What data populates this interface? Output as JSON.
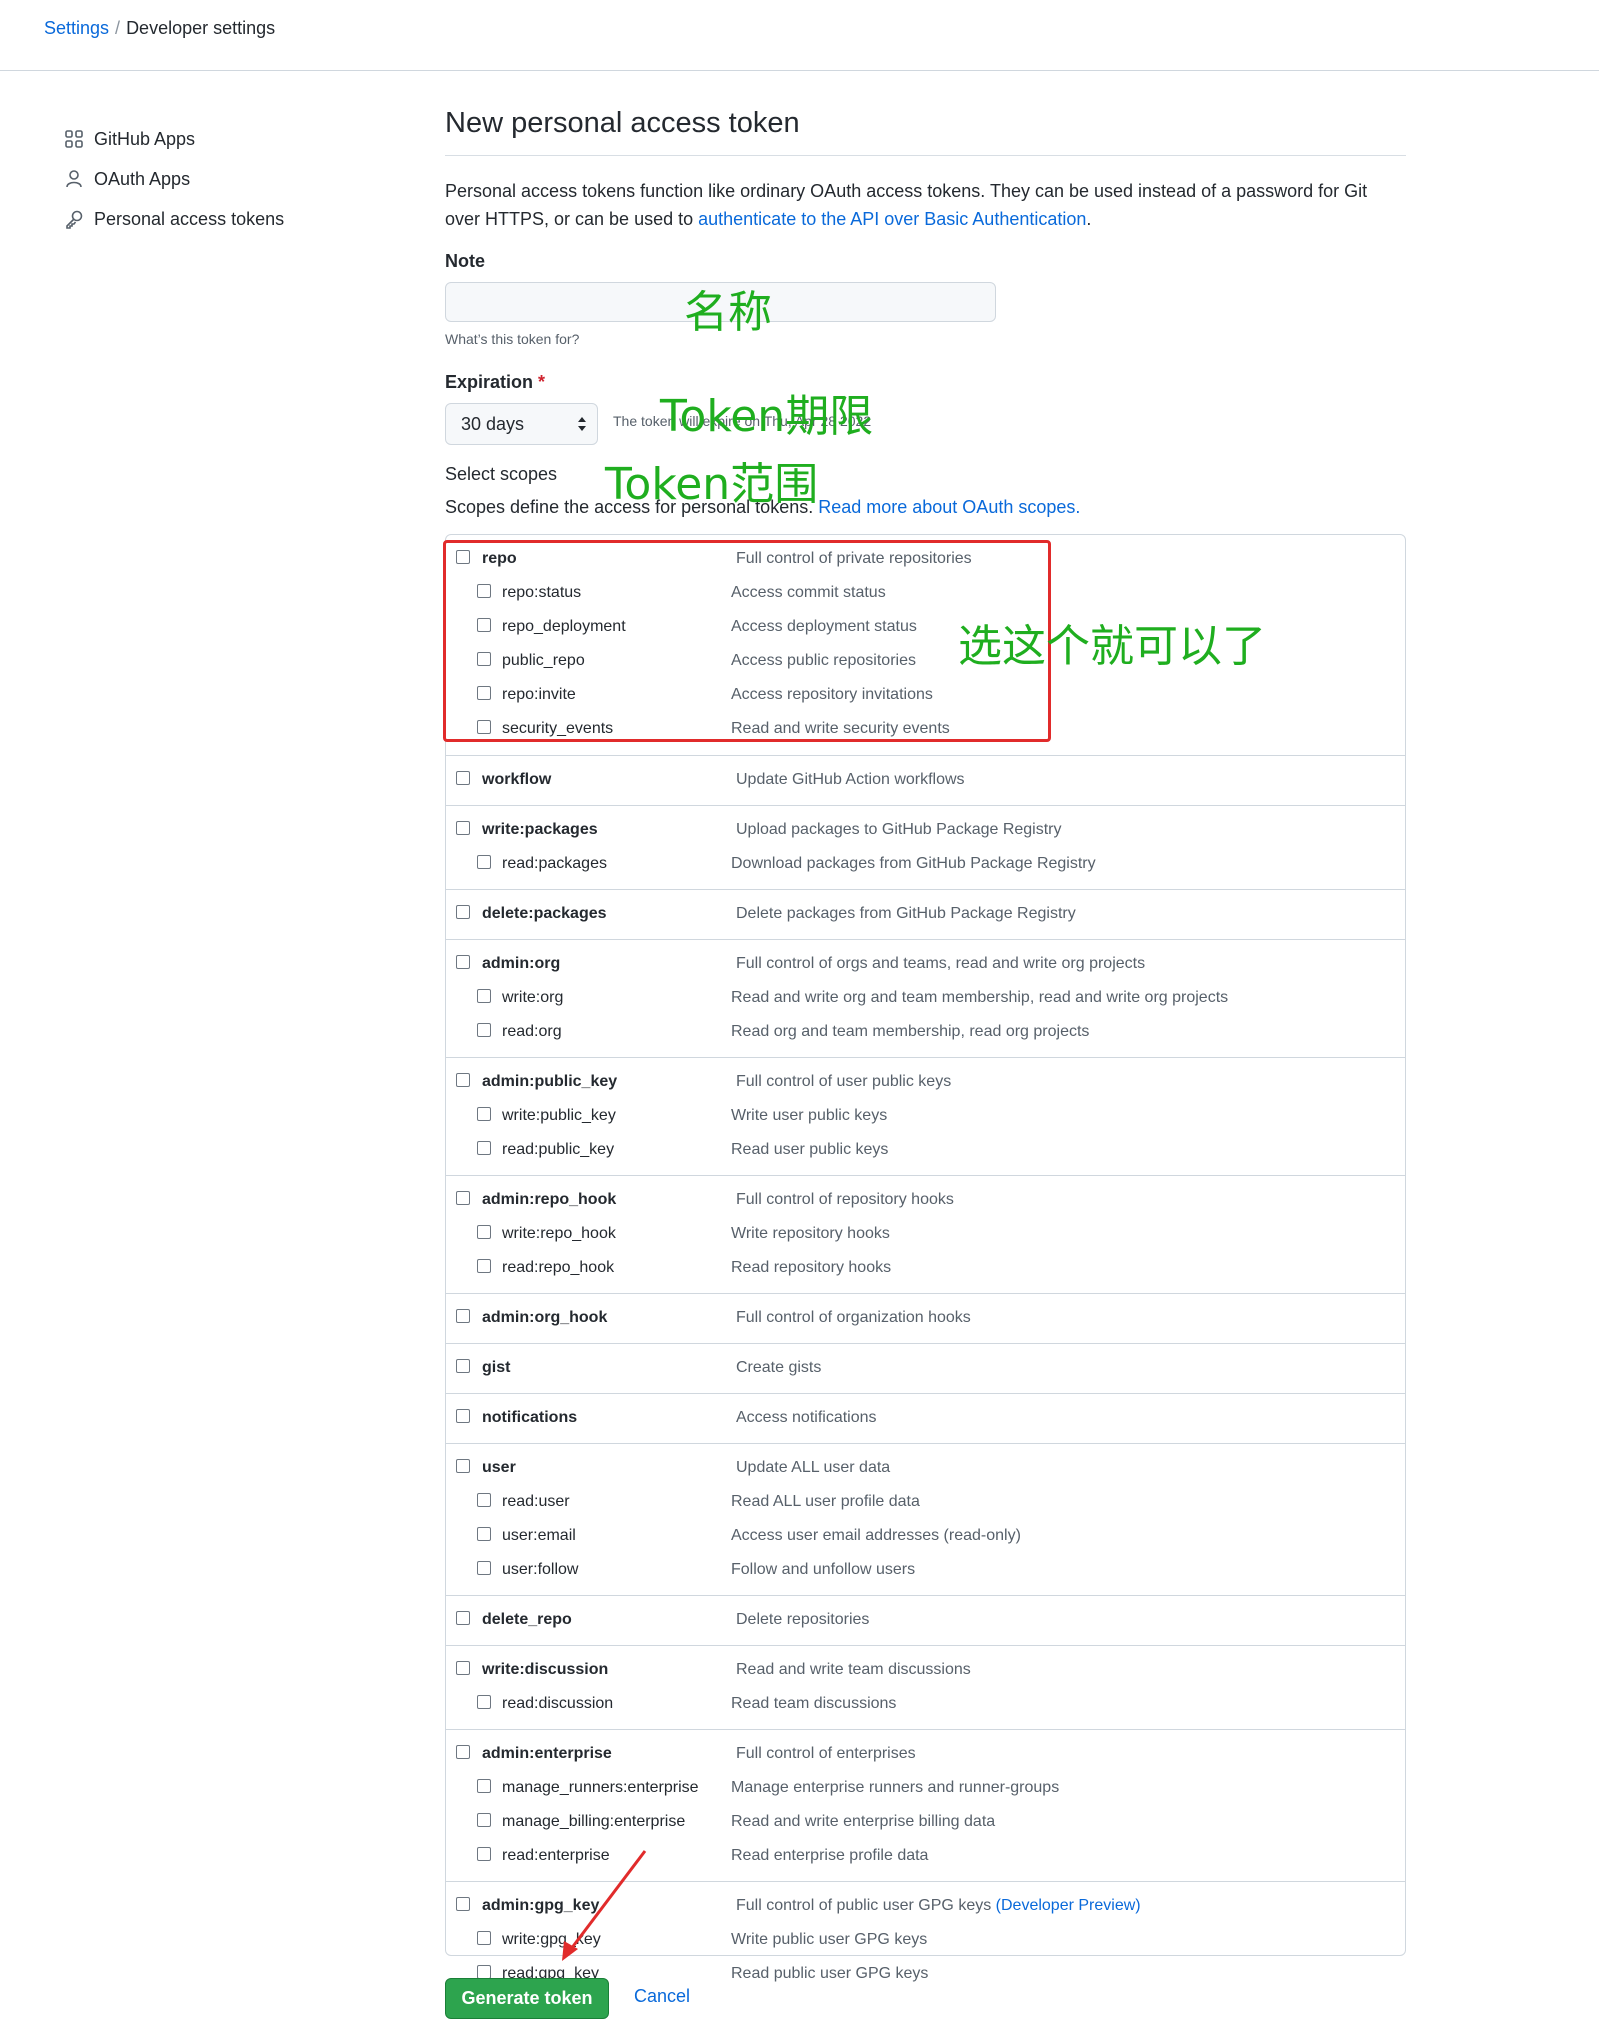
{
  "breadcrumb": {
    "settings": "Settings",
    "separator": "/",
    "current": "Developer settings"
  },
  "sidebar": {
    "items": [
      {
        "label": "GitHub Apps",
        "icon": "apps-grid-icon"
      },
      {
        "label": "OAuth Apps",
        "icon": "person-icon"
      },
      {
        "label": "Personal access tokens",
        "icon": "key-icon"
      }
    ]
  },
  "page": {
    "title": "New personal access token",
    "intro_text": "Personal access tokens function like ordinary OAuth access tokens. They can be used instead of a password for Git over HTTPS, or can be used to ",
    "intro_link": "authenticate to the API over Basic Authentication",
    "intro_end": "."
  },
  "note": {
    "label": "Note",
    "value": "",
    "hint": "What’s this token for?"
  },
  "expiration": {
    "label": "Expiration",
    "required_mark": "*",
    "selected": "30 days",
    "hint": "The token will expire on Thu, Apr 28 2022"
  },
  "scopes": {
    "label": "Select scopes",
    "description": "Scopes define the access for personal tokens. ",
    "link": "Read more about OAuth scopes.",
    "groups": [
      {
        "rows": [
          {
            "name": "repo",
            "desc": "Full control of private repositories"
          },
          {
            "name": "repo:status",
            "desc": "Access commit status"
          },
          {
            "name": "repo_deployment",
            "desc": "Access deployment status"
          },
          {
            "name": "public_repo",
            "desc": "Access public repositories"
          },
          {
            "name": "repo:invite",
            "desc": "Access repository invitations"
          },
          {
            "name": "security_events",
            "desc": "Read and write security events"
          }
        ]
      },
      {
        "rows": [
          {
            "name": "workflow",
            "desc": "Update GitHub Action workflows"
          }
        ]
      },
      {
        "rows": [
          {
            "name": "write:packages",
            "desc": "Upload packages to GitHub Package Registry"
          },
          {
            "name": "read:packages",
            "desc": "Download packages from GitHub Package Registry"
          }
        ]
      },
      {
        "rows": [
          {
            "name": "delete:packages",
            "desc": "Delete packages from GitHub Package Registry"
          }
        ]
      },
      {
        "rows": [
          {
            "name": "admin:org",
            "desc": "Full control of orgs and teams, read and write org projects"
          },
          {
            "name": "write:org",
            "desc": "Read and write org and team membership, read and write org projects"
          },
          {
            "name": "read:org",
            "desc": "Read org and team membership, read org projects"
          }
        ]
      },
      {
        "rows": [
          {
            "name": "admin:public_key",
            "desc": "Full control of user public keys"
          },
          {
            "name": "write:public_key",
            "desc": "Write user public keys"
          },
          {
            "name": "read:public_key",
            "desc": "Read user public keys"
          }
        ]
      },
      {
        "rows": [
          {
            "name": "admin:repo_hook",
            "desc": "Full control of repository hooks"
          },
          {
            "name": "write:repo_hook",
            "desc": "Write repository hooks"
          },
          {
            "name": "read:repo_hook",
            "desc": "Read repository hooks"
          }
        ]
      },
      {
        "rows": [
          {
            "name": "admin:org_hook",
            "desc": "Full control of organization hooks"
          }
        ]
      },
      {
        "rows": [
          {
            "name": "gist",
            "desc": "Create gists"
          }
        ]
      },
      {
        "rows": [
          {
            "name": "notifications",
            "desc": "Access notifications"
          }
        ]
      },
      {
        "rows": [
          {
            "name": "user",
            "desc": "Update ALL user data"
          },
          {
            "name": "read:user",
            "desc": "Read ALL user profile data"
          },
          {
            "name": "user:email",
            "desc": "Access user email addresses (read-only)"
          },
          {
            "name": "user:follow",
            "desc": "Follow and unfollow users"
          }
        ]
      },
      {
        "rows": [
          {
            "name": "delete_repo",
            "desc": "Delete repositories"
          }
        ]
      },
      {
        "rows": [
          {
            "name": "write:discussion",
            "desc": "Read and write team discussions"
          },
          {
            "name": "read:discussion",
            "desc": "Read team discussions"
          }
        ]
      },
      {
        "rows": [
          {
            "name": "admin:enterprise",
            "desc": "Full control of enterprises"
          },
          {
            "name": "manage_runners:enterprise",
            "desc": "Manage enterprise runners and runner-groups"
          },
          {
            "name": "manage_billing:enterprise",
            "desc": "Read and write enterprise billing data"
          },
          {
            "name": "read:enterprise",
            "desc": "Read enterprise profile data"
          }
        ]
      },
      {
        "rows": [
          {
            "name": "admin:gpg_key",
            "desc": "Full control of public user GPG keys",
            "desc_link": "(Developer Preview)"
          },
          {
            "name": "write:gpg_key",
            "desc": "Write public user GPG keys"
          },
          {
            "name": "read:gpg_key",
            "desc": "Read public user GPG keys"
          }
        ]
      }
    ]
  },
  "actions": {
    "generate": "Generate token",
    "cancel": "Cancel"
  },
  "annotations": {
    "note": "名称",
    "expiration": "Token期限",
    "scopes": "Token范围",
    "repo": "选这个就可以了",
    "color": "#1fae1f",
    "highlight_color": "#e12b2b"
  }
}
